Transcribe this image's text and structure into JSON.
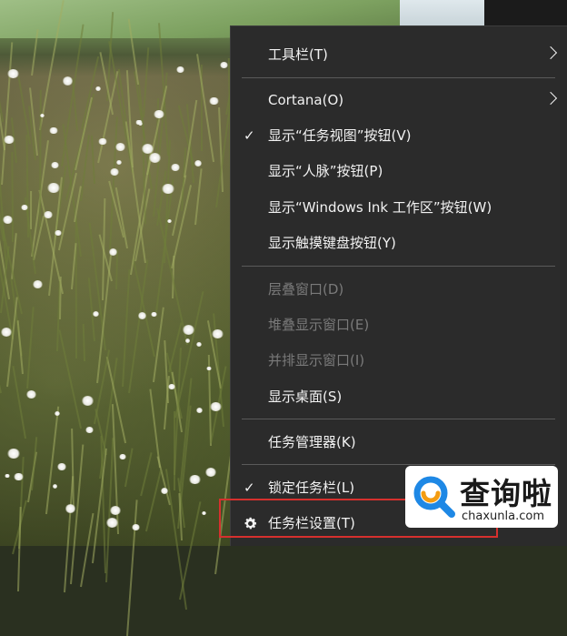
{
  "context_menu": {
    "items": [
      {
        "label": "工具栏(T)",
        "checked": false,
        "submenu": true,
        "enabled": true
      },
      {
        "label": "Cortana(O)",
        "checked": false,
        "submenu": true,
        "enabled": true
      },
      {
        "label": "显示“任务视图”按钮(V)",
        "checked": true,
        "submenu": false,
        "enabled": true
      },
      {
        "label": "显示“人脉”按钮(P)",
        "checked": false,
        "submenu": false,
        "enabled": true
      },
      {
        "label": "显示“Windows Ink 工作区”按钮(W)",
        "checked": false,
        "submenu": false,
        "enabled": true
      },
      {
        "label": "显示触摸键盘按钮(Y)",
        "checked": false,
        "submenu": false,
        "enabled": true
      },
      {
        "label": "层叠窗口(D)",
        "checked": false,
        "submenu": false,
        "enabled": false
      },
      {
        "label": "堆叠显示窗口(E)",
        "checked": false,
        "submenu": false,
        "enabled": false
      },
      {
        "label": "并排显示窗口(I)",
        "checked": false,
        "submenu": false,
        "enabled": false
      },
      {
        "label": "显示桌面(S)",
        "checked": false,
        "submenu": false,
        "enabled": true
      },
      {
        "label": "任务管理器(K)",
        "checked": false,
        "submenu": false,
        "enabled": true
      },
      {
        "label": "锁定任务栏(L)",
        "checked": true,
        "submenu": false,
        "enabled": true
      },
      {
        "label": "任务栏设置(T)",
        "checked": false,
        "submenu": false,
        "enabled": true,
        "icon": "gear-icon",
        "highlighted": true
      }
    ],
    "check_glyph": "✓"
  },
  "watermark": {
    "text": "查询啦",
    "url": "chaxunla.com",
    "icon": "search-magnifier-logo",
    "colors": {
      "accent_blue": "#1e88e5",
      "accent_orange": "#f39c12"
    }
  },
  "colors": {
    "menu_bg": "#2b2b2b",
    "menu_text": "#f2f2f2",
    "menu_text_disabled": "#7a7a7a",
    "separator": "#5a5a5a",
    "highlight_border": "#d6302e"
  }
}
